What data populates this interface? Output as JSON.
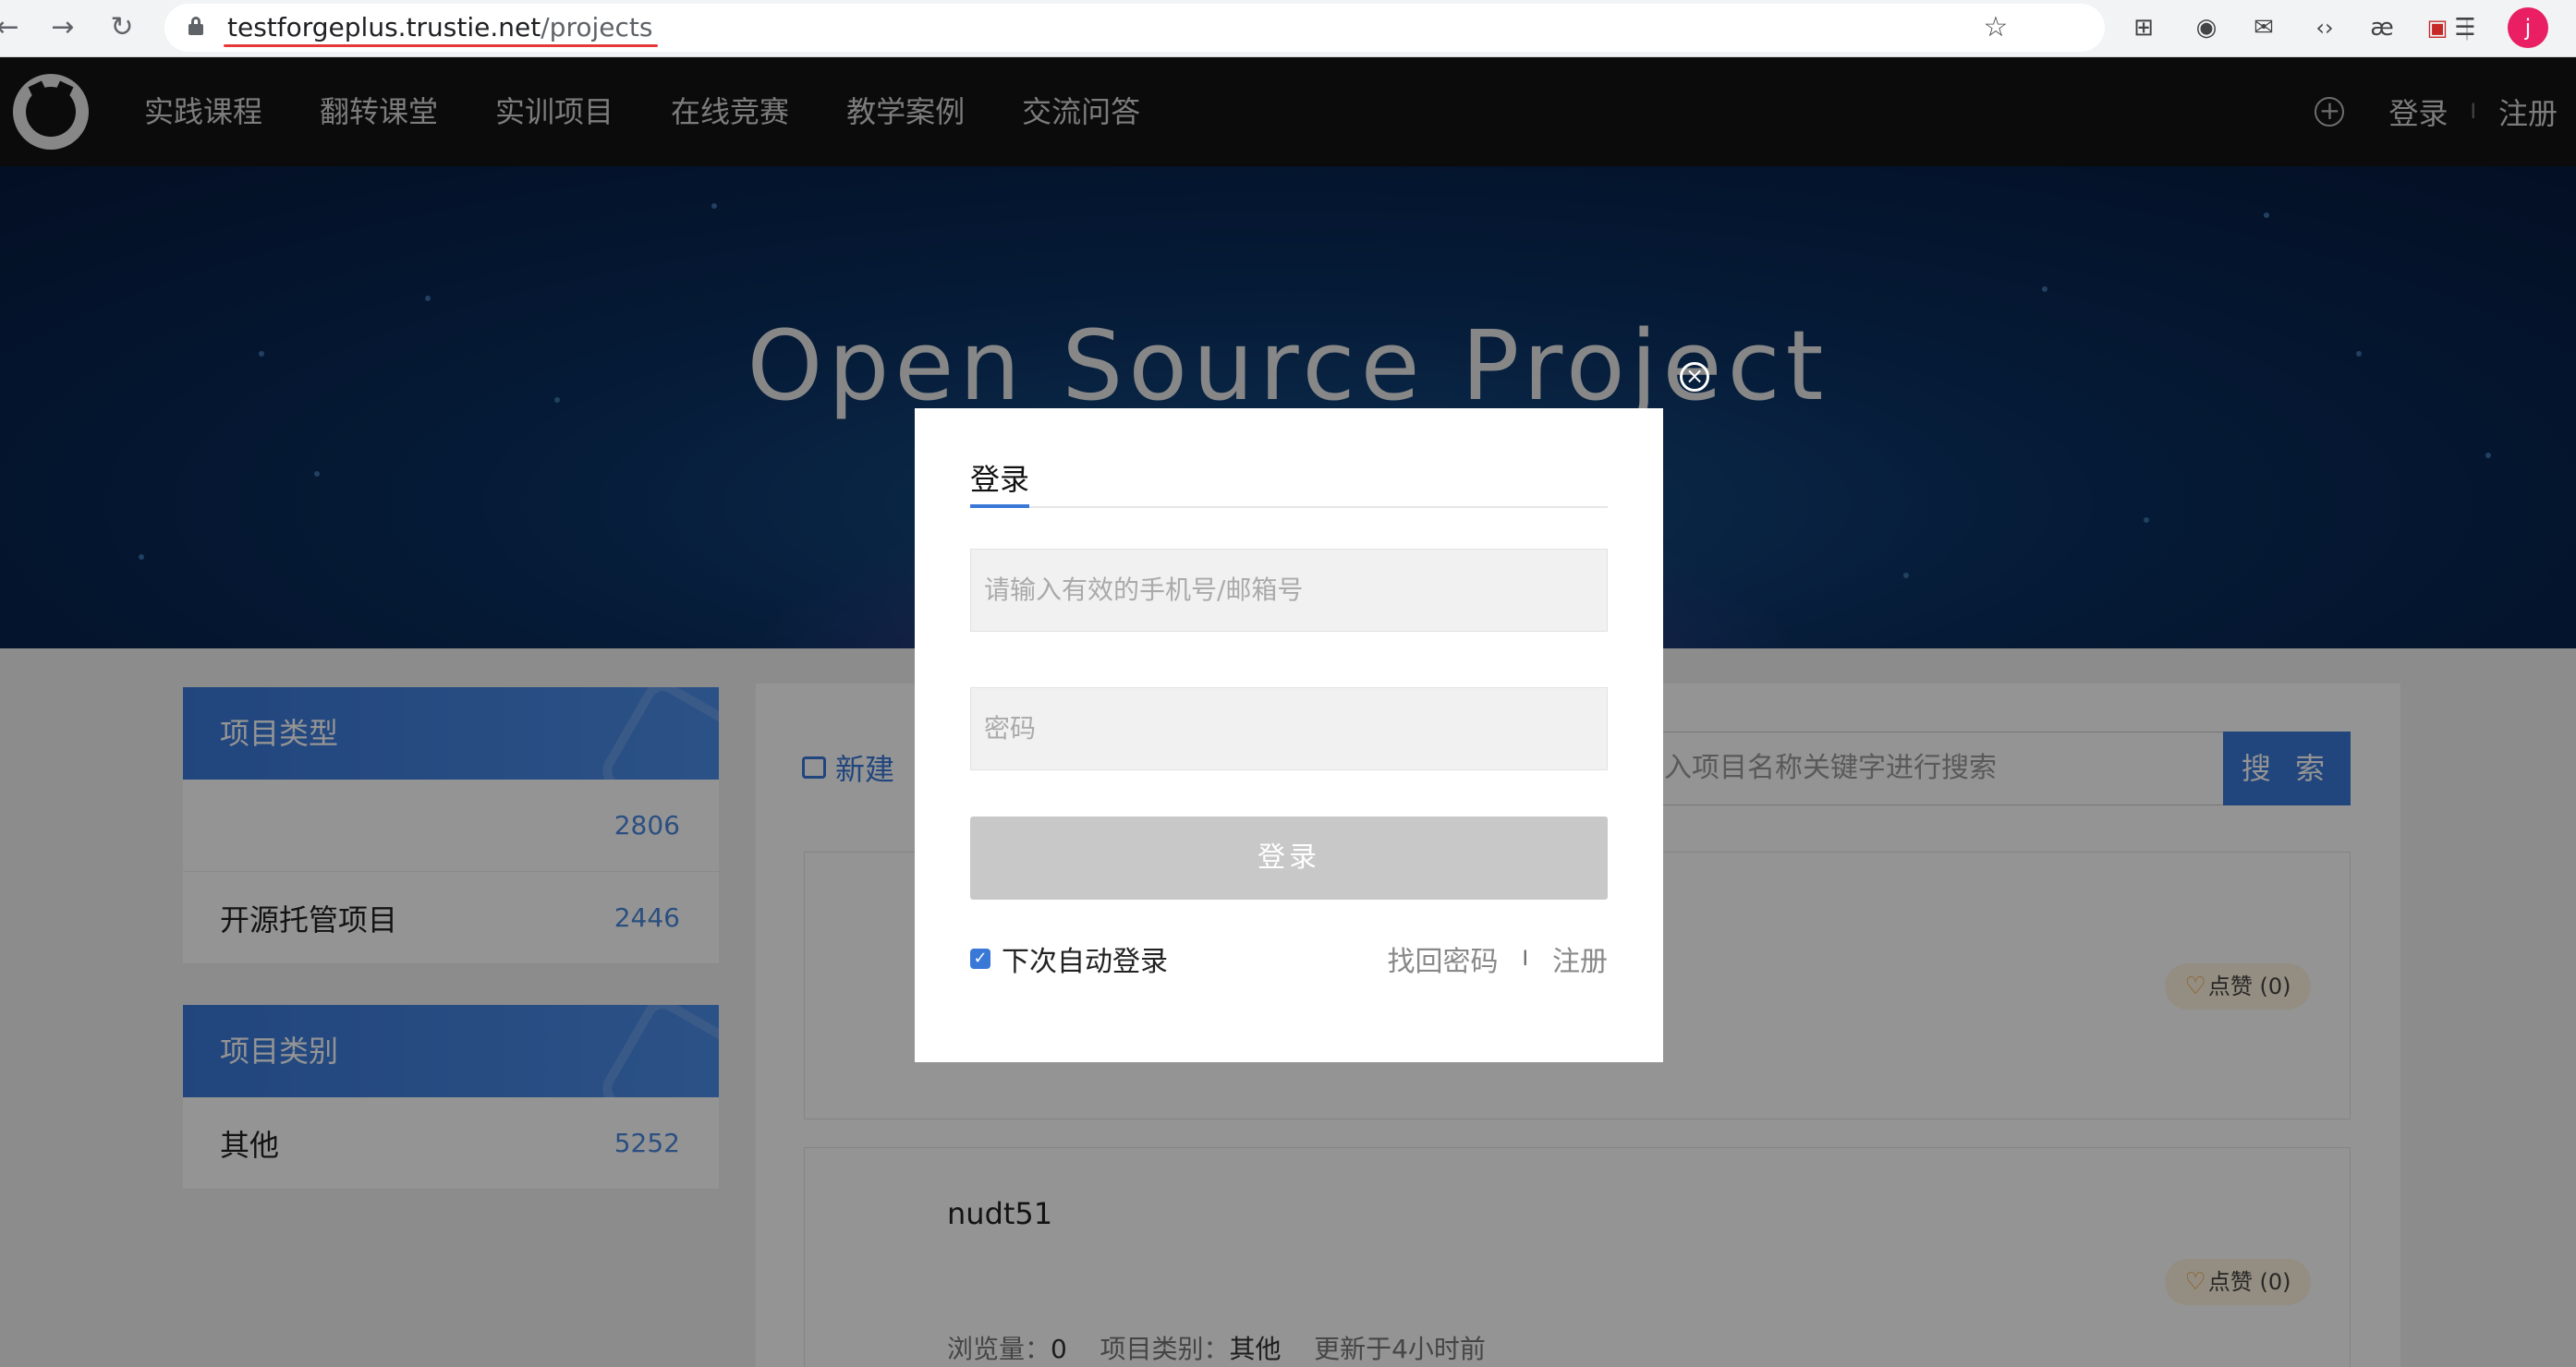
{
  "browser": {
    "url_host": "testforgeplus.trustie.net",
    "url_path": "/projects",
    "profile_initial": "j",
    "back_icon": "←",
    "forward_icon": "→",
    "reload_icon": "↻",
    "star_icon": "☆"
  },
  "nav": {
    "items": [
      "实践课程",
      "翻转课堂",
      "实训项目",
      "在线竞赛",
      "教学案例",
      "交流问答"
    ],
    "login": "登录",
    "separator": "I",
    "register": "注册"
  },
  "banner": {
    "title": "Open Source Project"
  },
  "sidebar": {
    "type_box": {
      "title": "项目类型",
      "rows": [
        {
          "label": "",
          "count": "2806"
        },
        {
          "label": "开源托管项目",
          "count": "2446"
        }
      ]
    },
    "category_box": {
      "title": "项目类别",
      "rows": [
        {
          "label": "其他",
          "count": "5252"
        }
      ]
    }
  },
  "main": {
    "new_label": "新建",
    "search_placeholder": "入项目名称关键字进行搜索",
    "search_button": "搜 索",
    "cards": [
      {
        "title": "",
        "like": "点赞 (0)",
        "meta_views_label": "",
        "meta_views": "",
        "meta_cat_label": "",
        "meta_cat": "",
        "meta_updated": ""
      },
      {
        "title": "nudt51",
        "like": "点赞 (0)",
        "meta_views_label": "浏览量：",
        "meta_views": "0",
        "meta_cat_label": "项目类别：",
        "meta_cat": "其他",
        "meta_updated": "更新于4小时前"
      }
    ]
  },
  "modal": {
    "tab": "登录",
    "account_placeholder": "请输入有效的手机号/邮箱号",
    "password_placeholder": "密码",
    "submit": "登录",
    "remember": "下次自动登录",
    "forgot": "找回密码",
    "separator": "I",
    "register": "注册"
  },
  "colors": {
    "accent": "#3a78d8",
    "nav_bg": "#141414"
  }
}
